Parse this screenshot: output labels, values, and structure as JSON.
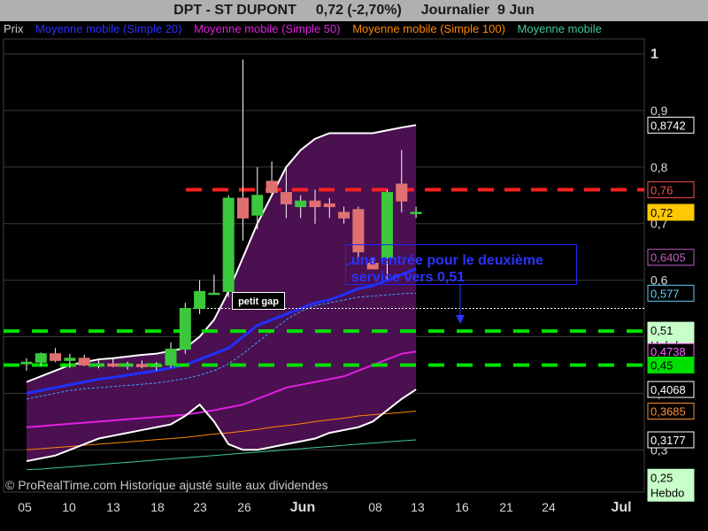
{
  "header": {
    "symbol": "DPT - ST DUPONT",
    "price_change": "0,72 (-2,70%)",
    "period": "Journalier  9 Jun"
  },
  "legend": [
    {
      "label": "Prix",
      "color": "#d0d0d0"
    },
    {
      "label": "Moyenne mobile (Simple 20)",
      "color": "#3030ff"
    },
    {
      "label": "Moyenne mobile (Simple 50)",
      "color": "#e020e0"
    },
    {
      "label": "Moyenne mobile (Simple 100)",
      "color": "#ff8800"
    },
    {
      "label": "Moyenne mobile",
      "color": "#40c8a0"
    }
  ],
  "footer": "© ProRealTime.com Historique ajusté suite aux dividendes",
  "annotations": {
    "note": "une entrée pour le deuxième service  vers 0,51",
    "gap": "petit gap"
  },
  "colors": {
    "up_candle": "#3cc83c",
    "down_candle": "#e07070",
    "band_fill": "#4a1050",
    "support": "#00e000",
    "resistance": "#ff2020"
  },
  "chart_data": {
    "type": "candlestick",
    "title": "DPT - ST DUPONT",
    "ylim": [
      0.25,
      1.0
    ],
    "y_ticks": [
      "1",
      "0,9",
      "0,8",
      "0,7",
      "0,6",
      "0,5",
      "0,4",
      "0,3"
    ],
    "x_ticks": [
      "05",
      "10",
      "13",
      "18",
      "23",
      "26",
      "Jun",
      "08",
      "13",
      "16",
      "21",
      "24",
      "Jul"
    ],
    "price_labels": [
      {
        "text": "0,8742",
        "value": 0.8742,
        "bg": "#000000",
        "fg": "#ffffff",
        "border": "#ffffff"
      },
      {
        "text": "0,76",
        "value": 0.76,
        "bg": "#000000",
        "fg": "#ff5050",
        "border": "#ff5050"
      },
      {
        "text": "0,72",
        "value": 0.72,
        "bg": "#ffc800",
        "fg": "#000000",
        "border": "#ffc800"
      },
      {
        "text": "0,6405",
        "value": 0.6405,
        "bg": "#000000",
        "fg": "#c060c0",
        "border": "#c060c0"
      },
      {
        "text": "0,577",
        "value": 0.577,
        "bg": "#000000",
        "fg": "#60d0ff",
        "border": "#60d0ff"
      },
      {
        "text": "0,51",
        "sub": "Hebdo",
        "value": 0.51,
        "bg": "#c8ffc8",
        "fg": "#000000",
        "border": "#c8ffc8"
      },
      {
        "text": "0,4738",
        "value": 0.4738,
        "bg": "#000000",
        "fg": "#ff60ff",
        "border": "#ff60ff"
      },
      {
        "text": "0,45",
        "value": 0.45,
        "bg": "#00e000",
        "fg": "#000000",
        "border": "#00e000"
      },
      {
        "text": "0,4068",
        "value": 0.4068,
        "bg": "#000000",
        "fg": "#ffffff",
        "border": "#ffffff"
      },
      {
        "text": "0,3685",
        "value": 0.3685,
        "bg": "#000000",
        "fg": "#ff9030",
        "border": "#ff9030"
      },
      {
        "text": "0,3177",
        "value": 0.3177,
        "bg": "#000000",
        "fg": "#ffffff",
        "border": "#ffffff"
      },
      {
        "text": "0,25",
        "sub": "Hebdo",
        "value": 0.25,
        "bg": "#c8ffc8",
        "fg": "#000000",
        "border": "#c8ffc8"
      }
    ],
    "horizontal_lines": [
      {
        "name": "resistance",
        "value": 0.76,
        "color": "#ff2020"
      },
      {
        "name": "support-upper",
        "value": 0.51,
        "color": "#00e000"
      },
      {
        "name": "support-lower",
        "value": 0.45,
        "color": "#00e000"
      },
      {
        "name": "gap",
        "value": 0.55,
        "color": "#ffffff"
      }
    ],
    "candles": [
      {
        "o": 0.452,
        "h": 0.462,
        "l": 0.44,
        "c": 0.455
      },
      {
        "o": 0.455,
        "h": 0.472,
        "l": 0.448,
        "c": 0.47
      },
      {
        "o": 0.47,
        "h": 0.48,
        "l": 0.455,
        "c": 0.458
      },
      {
        "o": 0.458,
        "h": 0.47,
        "l": 0.445,
        "c": 0.462
      },
      {
        "o": 0.462,
        "h": 0.468,
        "l": 0.448,
        "c": 0.45
      },
      {
        "o": 0.45,
        "h": 0.46,
        "l": 0.444,
        "c": 0.452
      },
      {
        "o": 0.452,
        "h": 0.462,
        "l": 0.446,
        "c": 0.448
      },
      {
        "o": 0.448,
        "h": 0.456,
        "l": 0.442,
        "c": 0.451
      },
      {
        "o": 0.451,
        "h": 0.458,
        "l": 0.444,
        "c": 0.447
      },
      {
        "o": 0.447,
        "h": 0.455,
        "l": 0.44,
        "c": 0.45
      },
      {
        "o": 0.45,
        "h": 0.49,
        "l": 0.445,
        "c": 0.478
      },
      {
        "o": 0.478,
        "h": 0.56,
        "l": 0.47,
        "c": 0.55
      },
      {
        "o": 0.55,
        "h": 0.6,
        "l": 0.54,
        "c": 0.58
      },
      {
        "o": 0.577,
        "h": 0.61,
        "l": 0.575,
        "c": 0.577
      },
      {
        "o": 0.58,
        "h": 0.75,
        "l": 0.57,
        "c": 0.745
      },
      {
        "o": 0.745,
        "h": 0.99,
        "l": 0.67,
        "c": 0.71
      },
      {
        "o": 0.715,
        "h": 0.8,
        "l": 0.69,
        "c": 0.75
      },
      {
        "o": 0.775,
        "h": 0.81,
        "l": 0.75,
        "c": 0.755
      },
      {
        "o": 0.755,
        "h": 0.8,
        "l": 0.71,
        "c": 0.735
      },
      {
        "o": 0.73,
        "h": 0.75,
        "l": 0.71,
        "c": 0.74
      },
      {
        "o": 0.74,
        "h": 0.76,
        "l": 0.7,
        "c": 0.73
      },
      {
        "o": 0.735,
        "h": 0.745,
        "l": 0.71,
        "c": 0.73
      },
      {
        "o": 0.72,
        "h": 0.73,
        "l": 0.7,
        "c": 0.71
      },
      {
        "o": 0.725,
        "h": 0.73,
        "l": 0.64,
        "c": 0.65
      },
      {
        "o": 0.63,
        "h": 0.64,
        "l": 0.62,
        "c": 0.62
      },
      {
        "o": 0.64,
        "h": 0.76,
        "l": 0.6,
        "c": 0.755
      },
      {
        "o": 0.77,
        "h": 0.83,
        "l": 0.72,
        "c": 0.74
      },
      {
        "o": 0.72,
        "h": 0.73,
        "l": 0.71,
        "c": 0.72
      }
    ],
    "series": [
      {
        "name": "Moyenne mobile (Simple 20)",
        "values": [
          0.4,
          0.405,
          0.41,
          0.415,
          0.42,
          0.425,
          0.428,
          0.432,
          0.436,
          0.44,
          0.445,
          0.45,
          0.46,
          0.47,
          0.48,
          0.5,
          0.52,
          0.53,
          0.54,
          0.55,
          0.56,
          0.565,
          0.575,
          0.585,
          0.59,
          0.6,
          0.61,
          0.62
        ]
      },
      {
        "name": "Moyenne mobile (Simple 50)",
        "values": [
          0.34,
          0.342,
          0.344,
          0.346,
          0.348,
          0.35,
          0.352,
          0.354,
          0.356,
          0.358,
          0.36,
          0.362,
          0.366,
          0.37,
          0.375,
          0.38,
          0.39,
          0.4,
          0.41,
          0.415,
          0.42,
          0.425,
          0.43,
          0.44,
          0.45,
          0.46,
          0.47,
          0.4738
        ]
      },
      {
        "name": "Moyenne mobile (Simple 100)",
        "values": [
          0.3,
          0.302,
          0.304,
          0.306,
          0.308,
          0.31,
          0.312,
          0.314,
          0.316,
          0.318,
          0.32,
          0.322,
          0.325,
          0.328,
          0.33,
          0.333,
          0.336,
          0.34,
          0.343,
          0.346,
          0.35,
          0.353,
          0.356,
          0.36,
          0.362,
          0.364,
          0.366,
          0.3685
        ]
      },
      {
        "name": "Moyenne mobile",
        "values": [
          0.265,
          0.266,
          0.268,
          0.27,
          0.272,
          0.274,
          0.276,
          0.278,
          0.28,
          0.282,
          0.284,
          0.286,
          0.288,
          0.29,
          0.292,
          0.294,
          0.296,
          0.298,
          0.3,
          0.302,
          0.304,
          0.306,
          0.308,
          0.31,
          0.312,
          0.314,
          0.316,
          0.3177
        ]
      },
      {
        "name": "bollinger-upper",
        "values": [
          0.42,
          0.43,
          0.44,
          0.45,
          0.455,
          0.46,
          0.462,
          0.465,
          0.468,
          0.47,
          0.475,
          0.48,
          0.5,
          0.53,
          0.58,
          0.64,
          0.7,
          0.75,
          0.8,
          0.83,
          0.85,
          0.86,
          0.86,
          0.86,
          0.86,
          0.865,
          0.87,
          0.8742
        ]
      },
      {
        "name": "bollinger-middle",
        "values": [
          0.39,
          0.395,
          0.4,
          0.405,
          0.408,
          0.41,
          0.412,
          0.414,
          0.416,
          0.418,
          0.422,
          0.426,
          0.432,
          0.44,
          0.452,
          0.47,
          0.49,
          0.51,
          0.53,
          0.545,
          0.555,
          0.56,
          0.565,
          0.57,
          0.572,
          0.574,
          0.576,
          0.577
        ]
      },
      {
        "name": "bollinger-lower",
        "values": [
          0.28,
          0.285,
          0.29,
          0.3,
          0.31,
          0.32,
          0.325,
          0.33,
          0.335,
          0.34,
          0.345,
          0.36,
          0.38,
          0.35,
          0.31,
          0.3,
          0.3,
          0.305,
          0.31,
          0.315,
          0.32,
          0.33,
          0.335,
          0.34,
          0.35,
          0.37,
          0.39,
          0.4068
        ]
      }
    ]
  }
}
